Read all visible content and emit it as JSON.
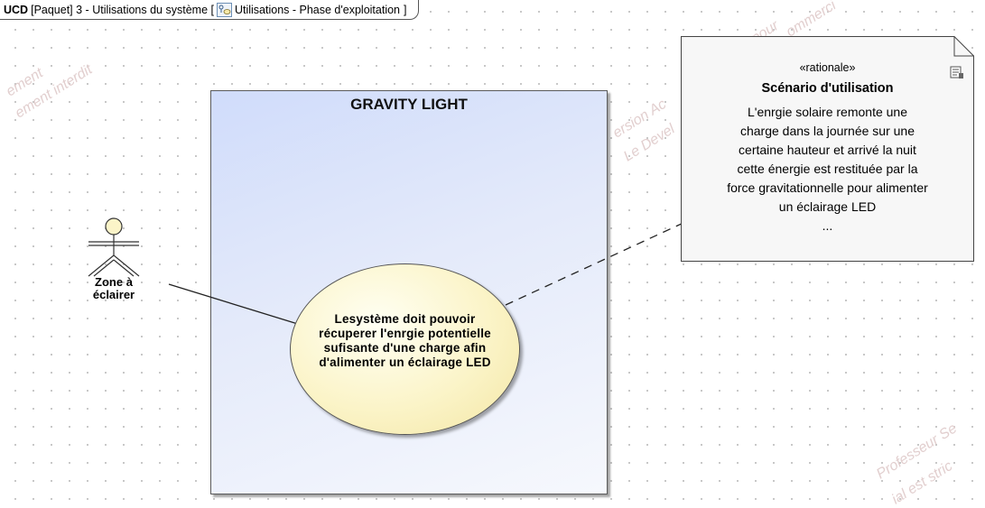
{
  "frame": {
    "kind": "UCD",
    "label_before": "[Paquet] 3 - Utilisations du système [",
    "diagram_name": "Utilisations - Phase d'exploitation",
    "label_after": "]"
  },
  "system": {
    "title": "GRAVITY LIGHT"
  },
  "actor": {
    "label": "Zone à\néclairer"
  },
  "use_case": {
    "label": "Lesystème doit pouvoir récuperer l'enrgie potentielle sufisante d'une charge afin d'alimenter un éclairage LED"
  },
  "note": {
    "stereotype": "«rationale»",
    "title": "Scénario d'utilisation",
    "body": "L'enrgie solaire remonte une\ncharge dans la journée sur une\ncertaine hauteur et arrivé la nuit\ncette énergie est restituée par la\nforce gravitationnelle pour alimenter\nun éclairage LED\n..."
  },
  "watermarks": [
    "ement",
    "ement interdit",
    "ersion Ac",
    "e pour",
    "Le Devel",
    "ommerci",
    "Professeur Se",
    "ial est stric"
  ],
  "colors": {
    "system_fill": "#d0dcfb",
    "use_case_fill": "#fbf4c8",
    "note_fill": "#f7f7f7",
    "watermark": "#e2cfcf"
  }
}
